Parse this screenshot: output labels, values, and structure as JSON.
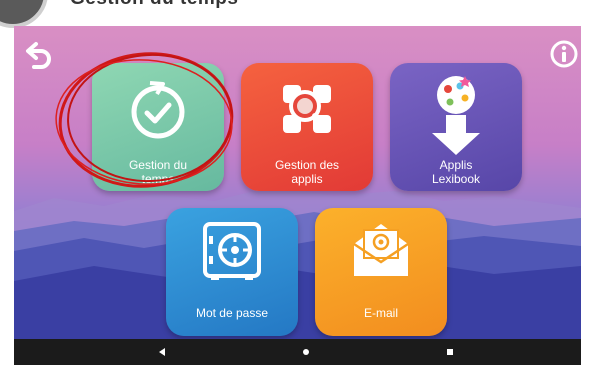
{
  "caption": "Gestion du temps",
  "tiles": [
    {
      "id": "gestion-temps",
      "label_line1": "Gestion du",
      "label_line2": "temps",
      "color": "#7dc9a9"
    },
    {
      "id": "gestion-applis",
      "label_line1": "Gestion des",
      "label_line2": "applis",
      "color": "#ef4d3c"
    },
    {
      "id": "applis-lexibook",
      "label_line1": "Applis",
      "label_line2": "Lexibook",
      "color": "#6b58b8"
    },
    {
      "id": "mot-de-passe",
      "label_line1": "Mot de passe",
      "label_line2": "",
      "color": "#2d8fd4"
    },
    {
      "id": "e-mail",
      "label_line1": "E-mail",
      "label_line2": "",
      "color": "#f7a124"
    }
  ],
  "icons": {
    "back": "back-arrow-icon",
    "info": "info-icon",
    "nav_back": "triangle-back-icon",
    "nav_home": "home-dot-icon",
    "nav_recents": "square-recents-icon"
  },
  "colors": {
    "annotation": "#d01818",
    "navbar": "#1b1b1b"
  }
}
